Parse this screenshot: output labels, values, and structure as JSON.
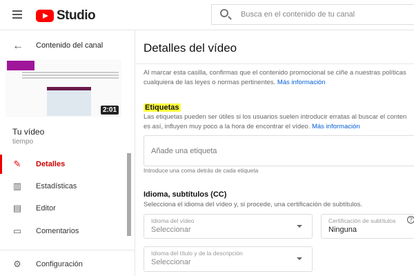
{
  "header": {
    "logo_text": "Studio",
    "search_placeholder": "Busca en el contenido de tu canal"
  },
  "sidebar": {
    "back_label": "Contenido del canal",
    "video_duration": "2:01",
    "video_title": "Tu vídeo",
    "video_subtitle": "tiempo",
    "items": [
      {
        "label": "Detalles",
        "icon": "pencil-icon",
        "active": true
      },
      {
        "label": "Estadísticas",
        "icon": "analytics-icon"
      },
      {
        "label": "Editor",
        "icon": "clapperboard-icon"
      },
      {
        "label": "Comentarios",
        "icon": "comment-icon"
      },
      {
        "label": "Configuración",
        "icon": "gear-icon"
      }
    ]
  },
  "main": {
    "title": "Detalles del vídeo",
    "promo_text_1": "Al marcar esta casilla, confirmas que el contenido promocional se ciñe a nuestras políticas",
    "promo_text_2": "cualquiera de las leyes o normas pertinentes.",
    "more_info": "Más información",
    "tags": {
      "heading": "Etiquetas",
      "desc_1": "Las etiquetas pueden ser útiles si los usuarios suelen introducir erratas al buscar el conten",
      "desc_2": "es así, influyen muy poco a la hora de encontrar el vídeo.",
      "placeholder": "Añade una etiqueta",
      "hint": "Introduce una coma detrás de cada etiqueta"
    },
    "language": {
      "heading": "Idioma, subtítulos (CC)",
      "desc": "Selecciona el idioma del vídeo y, si procede, una certificación de subtítulos.",
      "video_lang_label": "Idioma del vídeo",
      "video_lang_value": "Seleccionar",
      "cert_label": "Certificación de subtítulos",
      "cert_value": "Ninguna",
      "title_lang_label": "Idioma del título y de la descripción",
      "title_lang_value": "Seleccionar"
    }
  },
  "colors": {
    "accent": "#ff0000",
    "link": "#065fd4",
    "highlight": "#ffff40"
  }
}
